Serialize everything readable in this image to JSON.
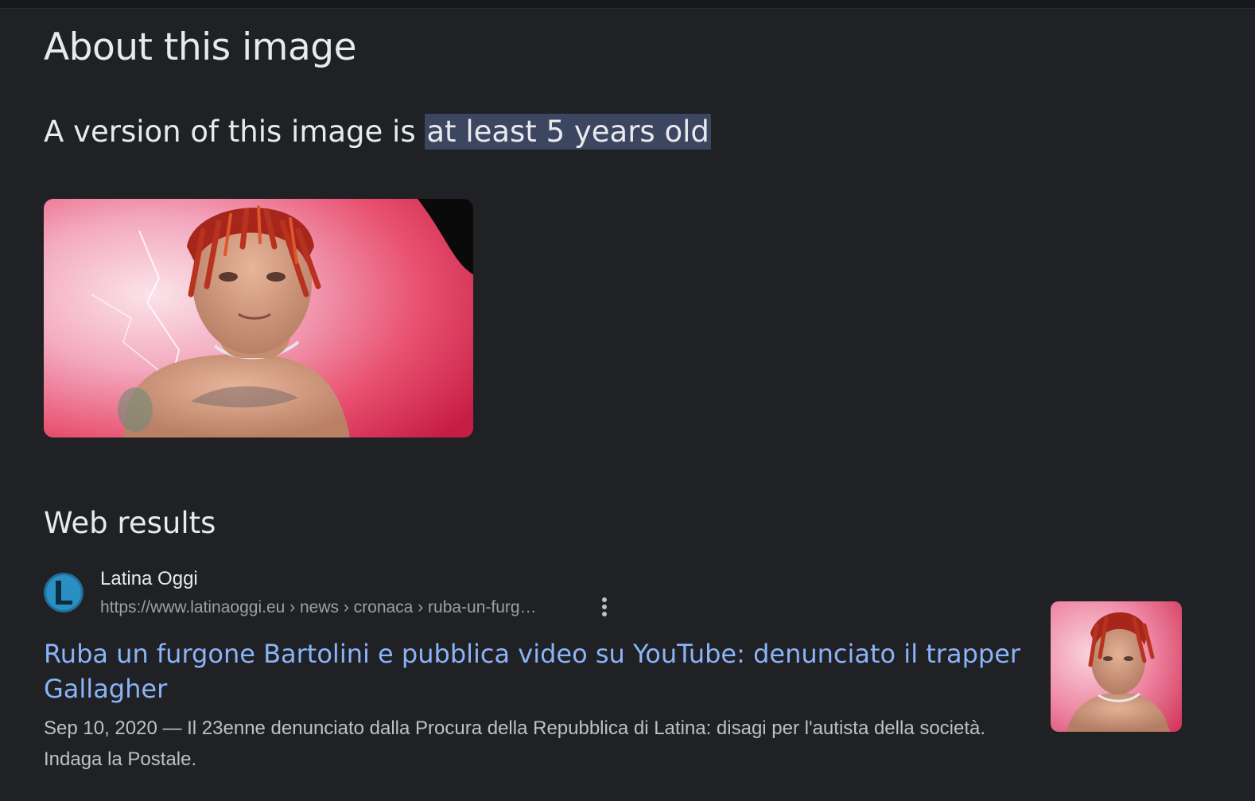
{
  "page": {
    "heading": "About this image",
    "age_prefix": "A version of this image is ",
    "age_highlight": "at least 5 years old"
  },
  "web_results": {
    "section_title": "Web results",
    "items": [
      {
        "site_name": "Latina Oggi",
        "url": "https://www.latinaoggi.eu › news › cronaca › ruba-un-furg…",
        "favicon_letter": "L",
        "title": "Ruba un furgone Bartolini e pubblica video su YouTube: denunciato il trapper Gallagher",
        "date": "Sep 10, 2020",
        "snippet": " — Il 23enne denunciato dalla Procura della Repubblica di Latina: disagi per l'autista della società. Indaga la Postale."
      }
    ]
  },
  "colors": {
    "background": "#202124",
    "link": "#8ab4f8",
    "highlight": "#3c4661",
    "text": "#e8eaed",
    "muted": "#bdc1c6"
  },
  "icons": {
    "more": "more-vert-icon",
    "favicon": "latina-oggi-logo-icon"
  }
}
